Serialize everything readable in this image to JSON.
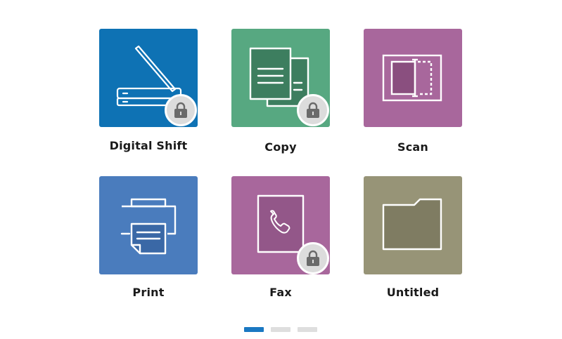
{
  "apps": [
    {
      "label": "Digital Shift",
      "icon": "scanner-icon",
      "color": "#0e72b4",
      "locked": true
    },
    {
      "label": "Copy",
      "icon": "copy-documents-icon",
      "color": "#57a881",
      "locked": true
    },
    {
      "label": "Scan",
      "icon": "scan-frame-icon",
      "color": "#a8679c",
      "locked": false
    },
    {
      "label": "Print",
      "icon": "printer-icon",
      "color": "#4a7cbd",
      "locked": false
    },
    {
      "label": "Fax",
      "icon": "fax-phone-icon",
      "color": "#a8679c",
      "locked": true
    },
    {
      "label": "Untitled",
      "icon": "folder-icon",
      "color": "#979477",
      "locked": false
    }
  ],
  "pagination": {
    "pages": 3,
    "current": 1,
    "active_color": "#1a78c2"
  }
}
